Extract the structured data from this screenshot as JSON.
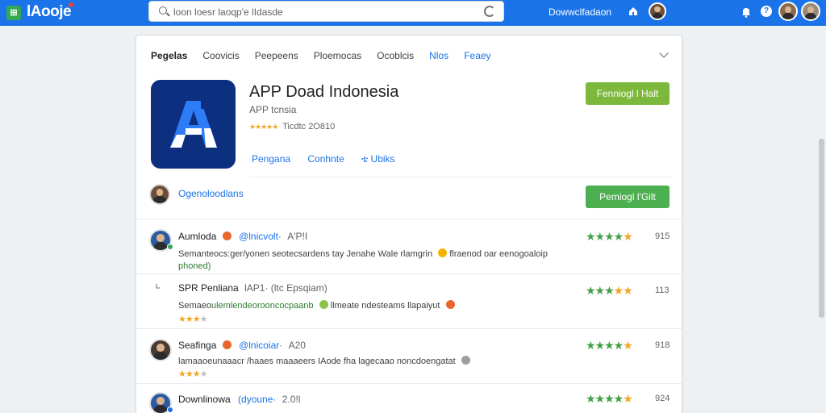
{
  "topbar": {
    "logo_badge": "⊞",
    "logo_text": "lAooje",
    "search_text": "loon loesr laoqp'e lIdasde",
    "download_link": "Dowwclfadaon"
  },
  "tabs": [
    {
      "label": "Pegelas"
    },
    {
      "label": "Coovicis"
    },
    {
      "label": "Peepeens"
    },
    {
      "label": "Ploemocas"
    },
    {
      "label": "Ocoblcis"
    },
    {
      "label": "Nlos"
    },
    {
      "label": "Feaey"
    }
  ],
  "app": {
    "title": "APP Doad Indonesia",
    "subtitle": "APP tcnsia",
    "rating_text": "Ticdtc  2O810",
    "install_label": "Fenniogl l Halt",
    "links": [
      "Pengana",
      "Conhnte",
      "ቴ Ubiks"
    ],
    "developer": "Ogenoloodlans",
    "install2_label": "Pemiogl l'Gilt",
    "icon_color": "#0d2f80"
  },
  "reviews": [
    {
      "name": "Aumloda",
      "handle": "@lnicvolt·",
      "when": "A'P!I",
      "text_a": "Semanteocs:ger/yonen seotecsardens tay  Jenahe Wale rlamgrin",
      "text_b": "  flraenod oar eenogoaloip",
      "text_c": "phoned)",
      "score": "915",
      "stars": 4
    },
    {
      "name": "SPR  Penliana",
      "handle": "",
      "when": "lAP1·  (ltc  Epsqiam)",
      "text_a": "Semaeo",
      "text_hl": "ulemlendeorooncocpaanb",
      "text_b": "  llmeate  ndesteams  llapaiyut",
      "score": "113",
      "stars": 3
    },
    {
      "name": "Seafinga",
      "handle": "@lnicoiar·",
      "when": "A20",
      "text_a": "lamaaoeunaaacr /haaes maaaeers IAode fha  lagecaao noncdoengatat",
      "score": "918",
      "stars": 3
    },
    {
      "name": "Downlinowa",
      "handle": "(dyoune·",
      "when": "2.0!l",
      "score": "924",
      "stars": 4
    }
  ]
}
